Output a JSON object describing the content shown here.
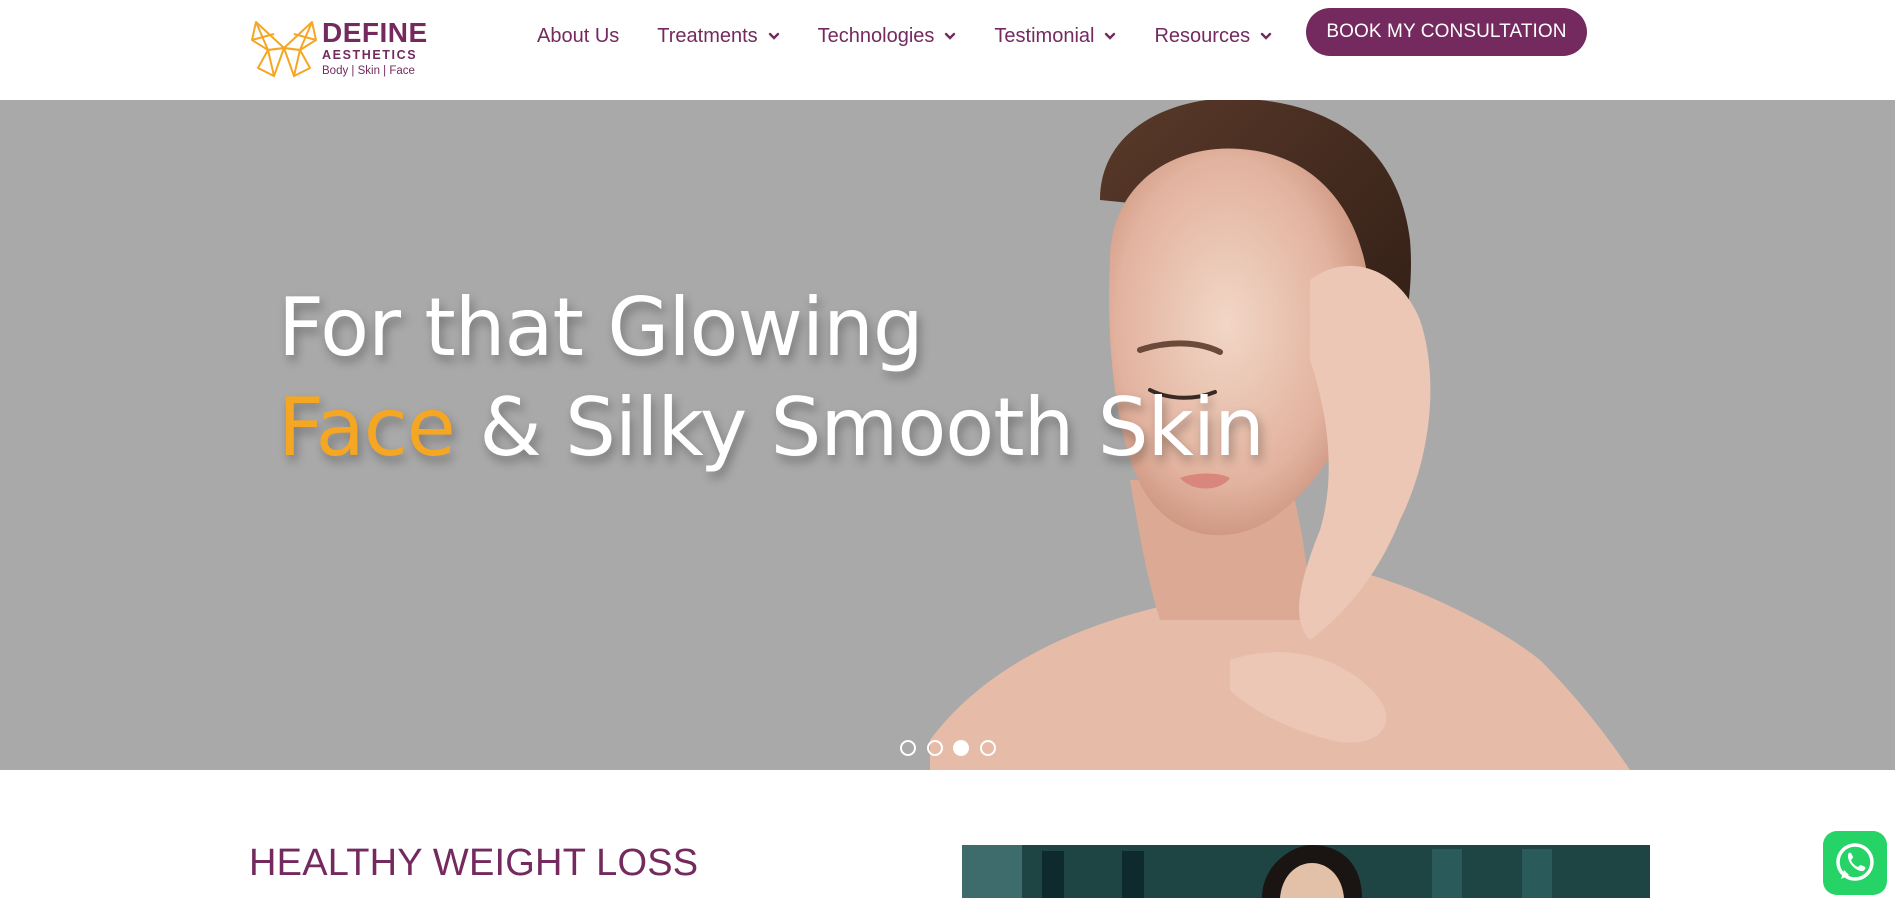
{
  "brand": {
    "name": "DEFINE",
    "sub": "AESTHETICS",
    "tagline": "Body | Skin | Face",
    "primary_color": "#742a5f",
    "accent_color": "#f5a623"
  },
  "nav": {
    "items": [
      {
        "label": "About Us",
        "has_dropdown": false
      },
      {
        "label": "Treatments",
        "has_dropdown": true
      },
      {
        "label": "Technologies",
        "has_dropdown": true
      },
      {
        "label": "Testimonial",
        "has_dropdown": true
      },
      {
        "label": "Resources",
        "has_dropdown": true
      }
    ],
    "cta_label": "BOOK MY CONSULTATION"
  },
  "hero": {
    "line1": "For that Glowing",
    "line2_accent": "Face",
    "line2_rest": " & Silky Smooth Skin",
    "slides_total": 4,
    "active_slide": 3
  },
  "section": {
    "title": "HEALTHY WEIGHT LOSS"
  },
  "floating": {
    "whatsapp_icon": "whatsapp-icon"
  }
}
